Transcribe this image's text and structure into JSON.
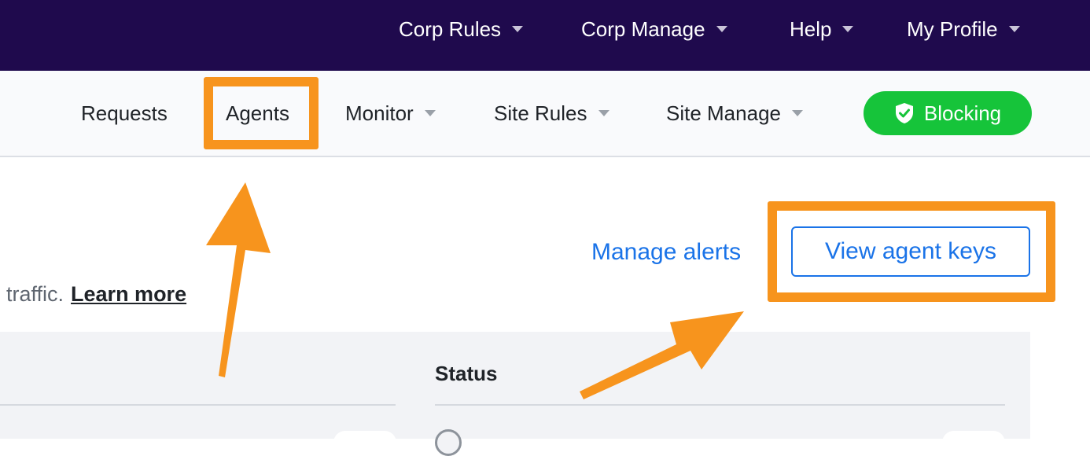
{
  "topnav": {
    "corp_rules": "Corp Rules",
    "corp_manage": "Corp Manage",
    "help": "Help",
    "my_profile": "My Profile"
  },
  "subnav": {
    "requests": "Requests",
    "agents": "Agents",
    "monitor": "Monitor",
    "site_rules": "Site Rules",
    "site_manage": "Site Manage",
    "blocking": "Blocking"
  },
  "content": {
    "manage_alerts": "Manage alerts",
    "view_agent_keys": "View agent keys",
    "description_fragment": "traffic.",
    "learn_more": "Learn more",
    "status_header": "Status"
  },
  "icons": {
    "blocking_status": "shield-check-icon",
    "dropdown": "chevron-down-icon"
  },
  "colors": {
    "topbar_bg": "#1f0a4d",
    "blocking_green": "#16c43a",
    "link_blue": "#1a73e8",
    "annotation_orange": "#f7941d"
  }
}
